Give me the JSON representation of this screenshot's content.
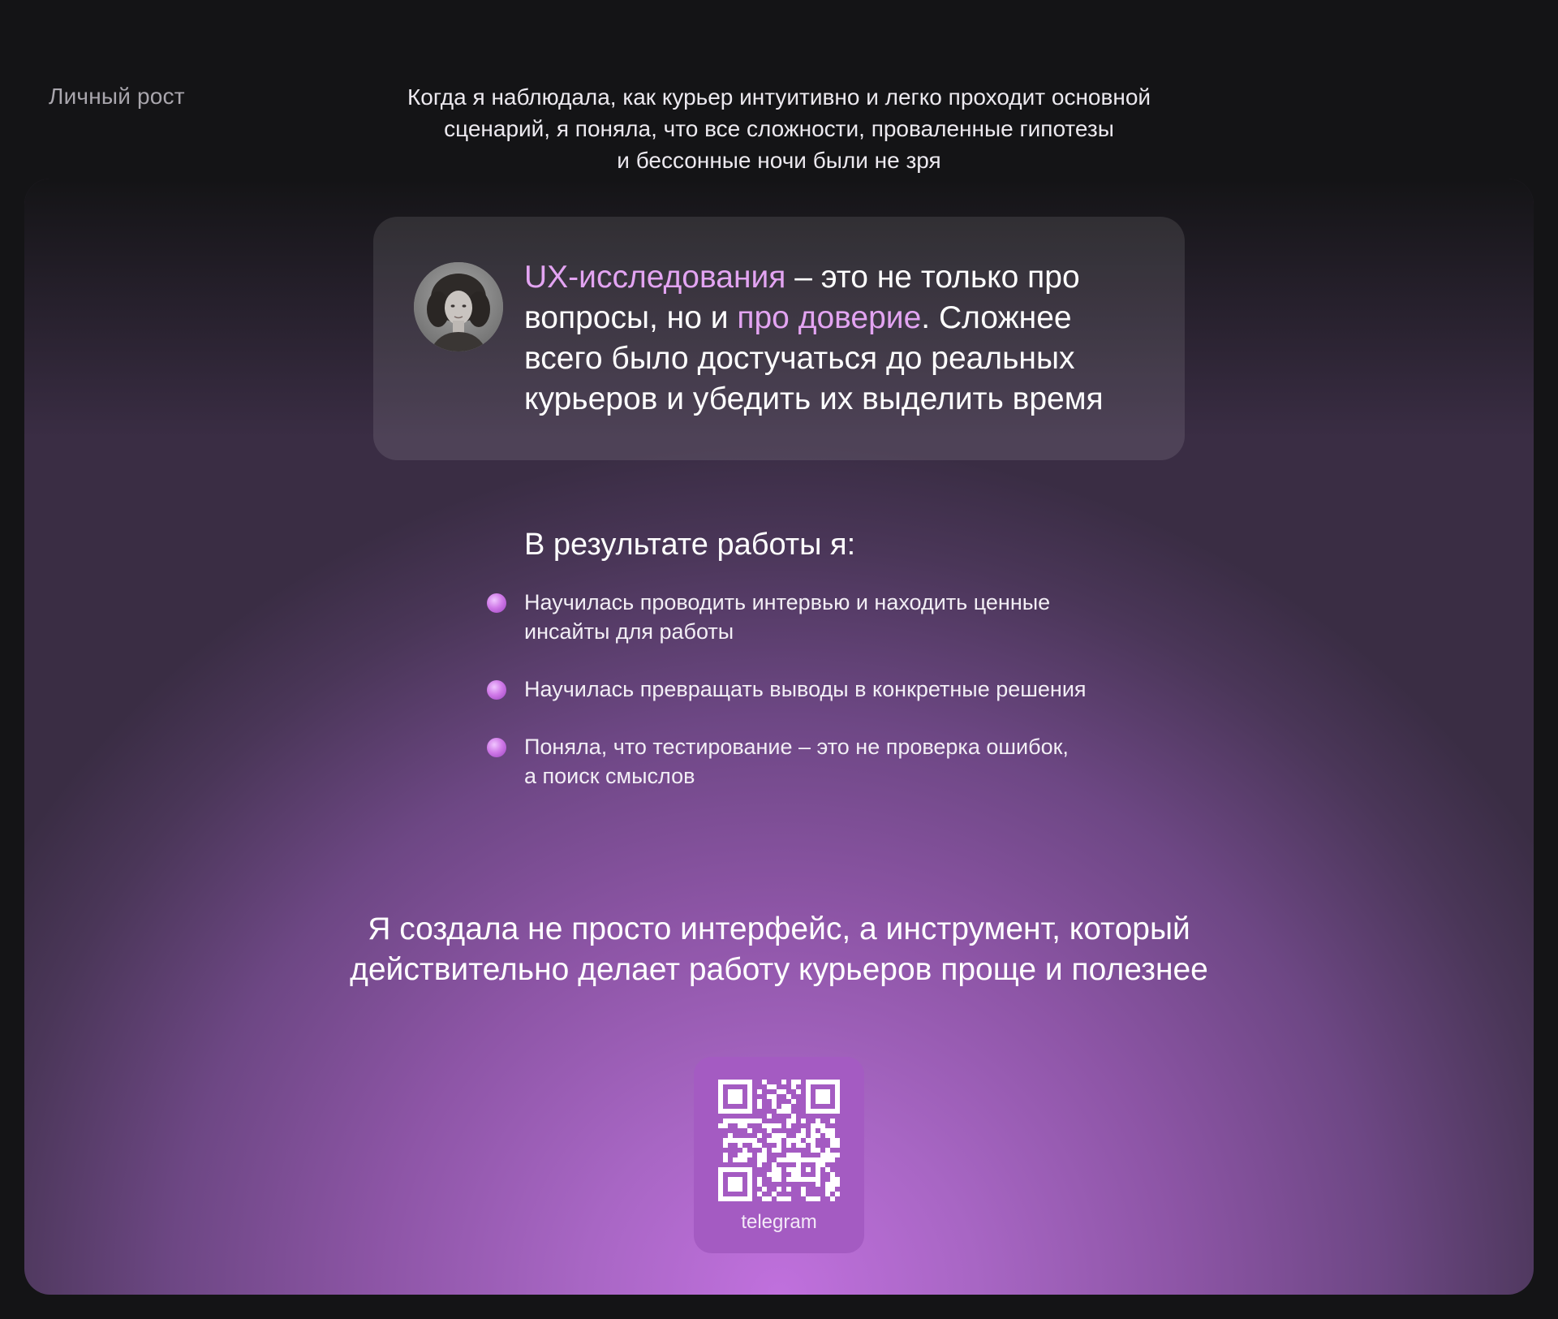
{
  "section": {
    "label": "Личный рост"
  },
  "intro": {
    "lines": [
      "Когда я наблюдала, как курьер интуитивно и легко проходит основной",
      "сценарий, я поняла, что все сложности, проваленные гипотезы",
      "и бессонные ночи были не зря"
    ]
  },
  "quote": {
    "accent_1": "UX-исследования",
    "text_1": " – это не только про вопросы, но и ",
    "accent_2": "про доверие",
    "text_2": ". Сложнее всего было достучаться до реальных курьеров и убедить их выделить время",
    "avatar_icon": "person-portrait-icon"
  },
  "results": {
    "title": "В результате работы я:",
    "items": [
      {
        "line_1": "Научилась проводить интервью и находить ценные",
        "line_2": "инсайты для работы"
      },
      {
        "line_1": "Научилась превращать выводы в конкретные решения",
        "line_2": ""
      },
      {
        "line_1": "Поняла, что тестирование – это не проверка ошибок,",
        "line_2": "а поиск смыслов"
      }
    ]
  },
  "closing": {
    "line_1": "Я создала не просто интерфейс, а инструмент, который",
    "line_2": "действительно делает работу курьеров проще и полезнее"
  },
  "contact": {
    "qr_label": "telegram",
    "qr_icon": "qr-code-icon"
  },
  "colors": {
    "accent": "#e3a4f2",
    "background": "#141416",
    "card": "#a45bc2"
  }
}
